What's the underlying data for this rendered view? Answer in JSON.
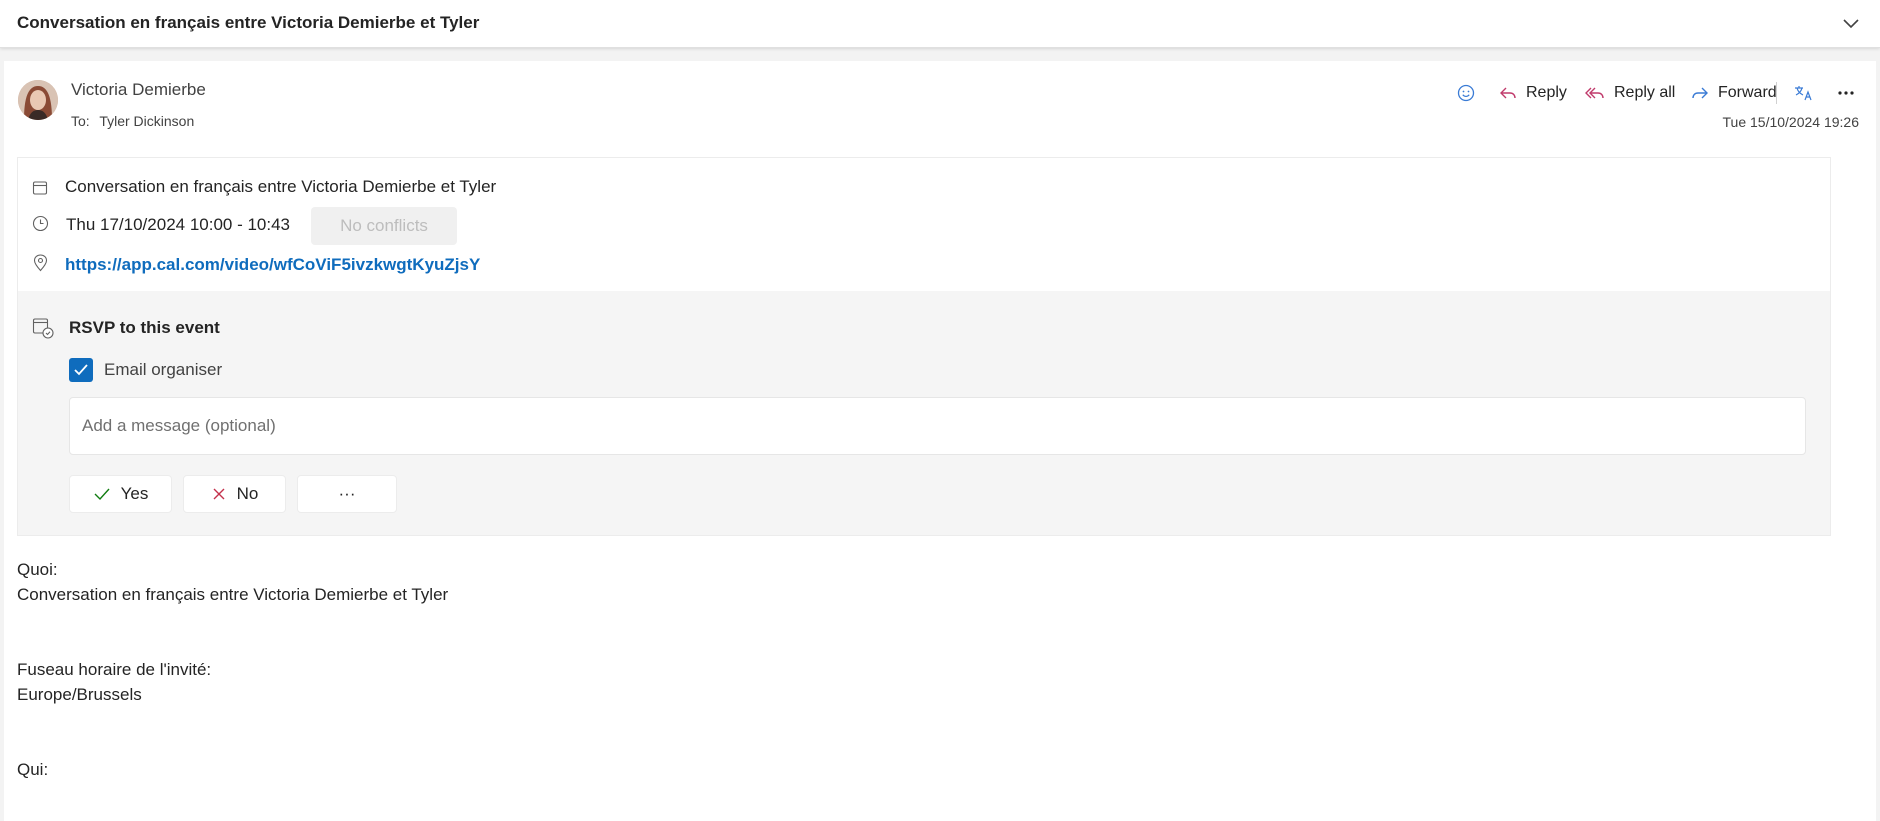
{
  "conversation": {
    "subject": "Conversation en français entre Victoria Demierbe et Tyler"
  },
  "message": {
    "sender": "Victoria Demierbe",
    "to_label": "To:",
    "recipient": "Tyler Dickinson",
    "date": "Tue 15/10/2024 19:26",
    "actions": {
      "reply": "Reply",
      "reply_all": "Reply all",
      "forward": "Forward"
    }
  },
  "event": {
    "title": "Conversation en français entre Victoria Demierbe et Tyler",
    "time": "Thu 17/10/2024 10:00 - 10:43",
    "conflicts": "No conflicts",
    "link": "https://app.cal.com/video/wfCoViF5ivzkwgtKyuZjsY"
  },
  "rsvp": {
    "title": "RSVP to this event",
    "email_organiser_label": "Email organiser",
    "email_organiser_checked": true,
    "message_placeholder": "Add a message (optional)",
    "yes_label": "Yes",
    "no_label": "No",
    "more_label": "···"
  },
  "body": {
    "quoi_label": "Quoi:",
    "quoi_value": "Conversation en français entre Victoria Demierbe et Tyler",
    "timezone_label": "Fuseau horaire de l'invité:",
    "timezone_value": "Europe/Brussels",
    "qui_label": "Qui:"
  },
  "colors": {
    "accent": "#0f6cbd",
    "reply_icon": "#c03a6b",
    "forward_icon": "#3a7bd5",
    "yes_icon": "#107c10",
    "no_icon": "#c4314b"
  },
  "icons": [
    "chevron-down-icon",
    "emoji-icon",
    "reply-icon",
    "reply-all-icon",
    "forward-icon",
    "translate-icon",
    "more-icon",
    "calendar-icon",
    "clock-icon",
    "location-icon",
    "rsvp-calendar-icon",
    "checkmark-icon",
    "yes-check-icon",
    "no-x-icon"
  ]
}
